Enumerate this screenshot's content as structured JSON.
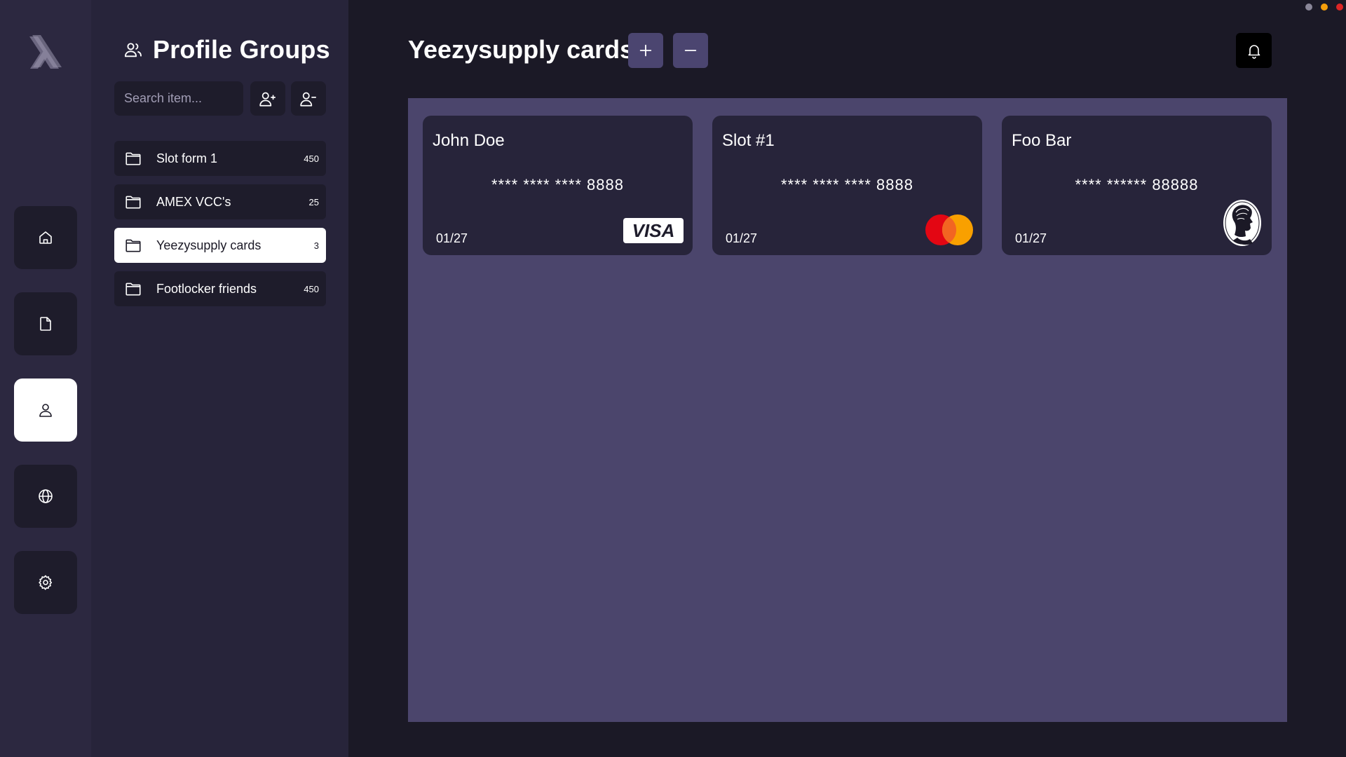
{
  "window": {
    "dots": [
      {
        "name": "minimize-dot",
        "color": "#8a8799"
      },
      {
        "name": "maximize-dot",
        "color": "#f59e0b"
      },
      {
        "name": "close-dot",
        "color": "#dc2626"
      }
    ]
  },
  "rail": {
    "logo_icon": "lambda-logo",
    "items": [
      {
        "name": "home",
        "icon": "home-icon",
        "active": false
      },
      {
        "name": "files",
        "icon": "file-icon",
        "active": false
      },
      {
        "name": "profiles",
        "icon": "user-icon",
        "active": true
      },
      {
        "name": "proxies",
        "icon": "globe-icon",
        "active": false
      },
      {
        "name": "settings",
        "icon": "gear-icon",
        "active": false
      }
    ]
  },
  "groups_panel": {
    "title": "Profile Groups",
    "search_placeholder": "Search item...",
    "add_group_icon": "user-plus-icon",
    "remove_group_icon": "user-minus-icon",
    "items": [
      {
        "label": "Slot form 1",
        "count": "450",
        "active": false
      },
      {
        "label": "AMEX VCC's",
        "count": "25",
        "active": false
      },
      {
        "label": "Yeezysupply cards",
        "count": "3",
        "active": true
      },
      {
        "label": "Footlocker friends",
        "count": "450",
        "active": false
      }
    ]
  },
  "main": {
    "title": "Yeezysupply cards",
    "add_icon": "plus-icon",
    "remove_icon": "minus-icon",
    "notification_icon": "bell-icon",
    "cards": [
      {
        "holder": "John Doe",
        "number": "**** **** **** 8888",
        "expiry": "01/27",
        "brand": "VISA",
        "brand_icon": "visa-logo"
      },
      {
        "holder": "Slot #1",
        "number": "**** **** **** 8888",
        "expiry": "01/27",
        "brand": "mastercard",
        "brand_icon": "mastercard-logo"
      },
      {
        "holder": "Foo Bar",
        "number": "**** ****** 88888",
        "expiry": "01/27",
        "brand": "amex",
        "brand_icon": "amex-centurion-logo"
      }
    ]
  },
  "colors": {
    "background": "#1b1926",
    "rail": "#2c2840",
    "panel": "#27243a",
    "item": "#1e1c2b",
    "accent": "#4b4570",
    "cards_area": "#4b456c"
  }
}
